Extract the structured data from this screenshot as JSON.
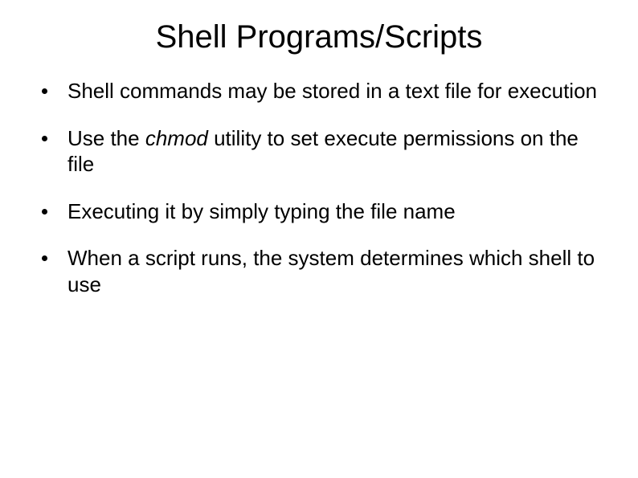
{
  "slide": {
    "title": "Shell Programs/Scripts",
    "bullets": [
      {
        "text_before": "Shell commands may be stored in a text file for execution",
        "italic": "",
        "text_after": ""
      },
      {
        "text_before": "Use the ",
        "italic": "chmod",
        "text_after": " utility to set execute permissions on the file"
      },
      {
        "text_before": "Executing it by simply typing the file name",
        "italic": "",
        "text_after": ""
      },
      {
        "text_before": "When a script runs, the system determines which shell to use",
        "italic": "",
        "text_after": ""
      }
    ]
  }
}
